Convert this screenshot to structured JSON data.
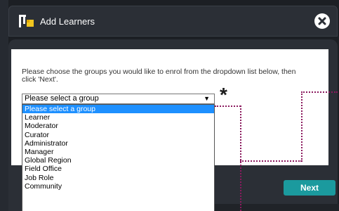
{
  "dialog": {
    "title": "Add Learners",
    "instruction": "Please choose the groups you would like to enrol from the dropdown list below, then click 'Next'.",
    "required_marker": "*",
    "next_label": "Next"
  },
  "select": {
    "value": "Please select a group",
    "options": [
      "Please select a group",
      "Learner",
      "Moderator",
      "Curator",
      "Administrator",
      "Manager",
      "Global Region",
      "Field Office",
      "Job Role",
      "Community"
    ]
  },
  "colors": {
    "accent": "#1b9a9e",
    "highlight": "#1e90ff",
    "dotted_annotation": "#8b1a5e",
    "frame": "#2b2f36"
  }
}
